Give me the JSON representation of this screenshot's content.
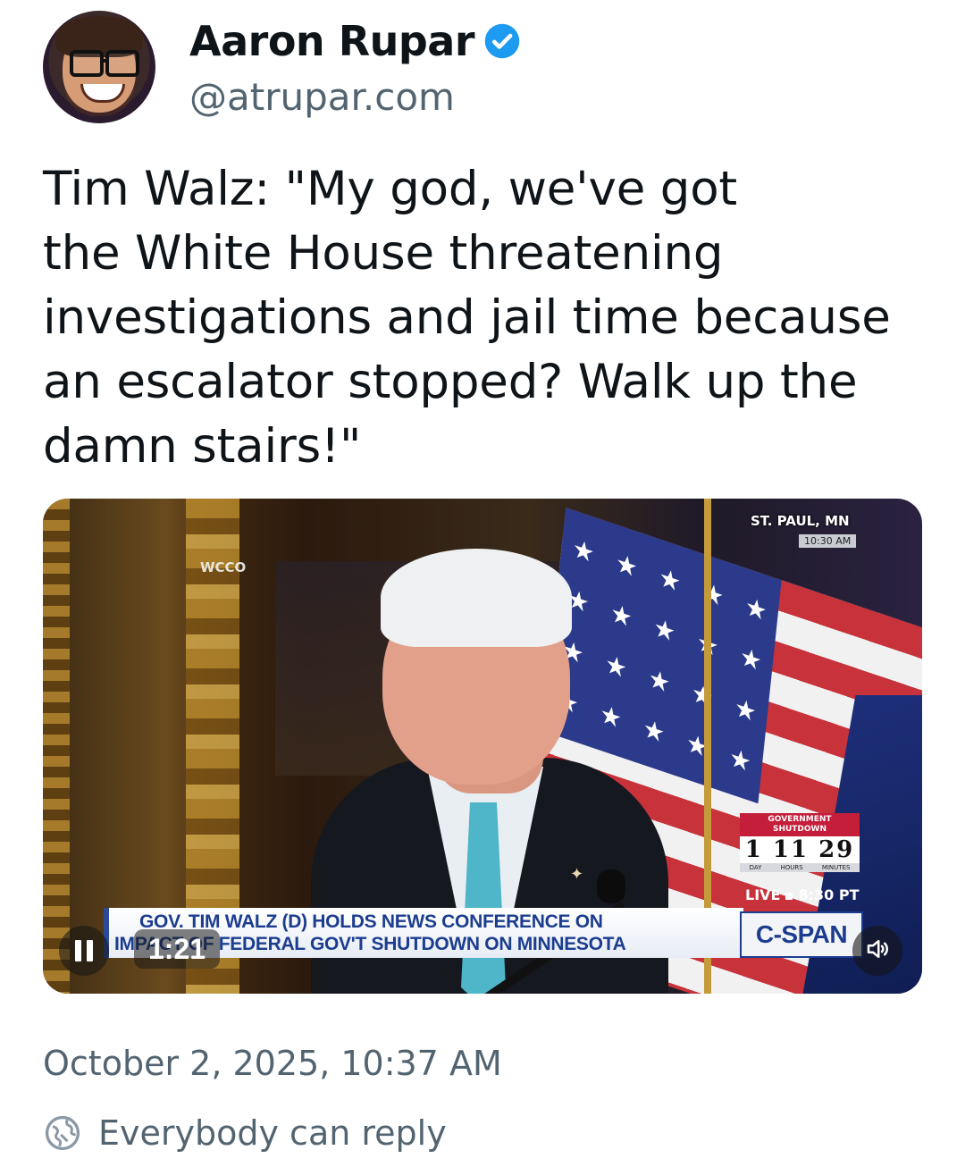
{
  "author": {
    "display_name": "Aaron Rupar",
    "handle": "@atrupar.com",
    "verified": true,
    "verified_color": "#1d9bf0"
  },
  "post": {
    "text": "Tim Walz: \"My god, we've got\nthe White House threatening\ninvestigations and jail time because\nan escalator stopped? Walk up the\ndamn stairs!\""
  },
  "video": {
    "elapsed_time": "1:21",
    "state": "playing",
    "overlays": {
      "station": "WCCO",
      "location": "ST. PAUL, MN",
      "location_time": "10:30 AM",
      "shutdown_label_1": "GOVERNMENT",
      "shutdown_label_2": "SHUTDOWN",
      "shutdown_digits": "1 11 29",
      "shutdown_unit_day": "DAY",
      "shutdown_unit_hours": "HOURS",
      "shutdown_unit_minutes": "MINUTES",
      "live_label": "LIVE",
      "live_time": "8:30 PT",
      "chyron_line1": "GOV. TIM WALZ (D) HOLDS NEWS CONFERENCE ON",
      "chyron_line2": "IMPACT OF FEDERAL GOV'T SHUTDOWN ON MINNESOTA",
      "network": "C-SPAN"
    },
    "icons": {
      "pause": "pause-icon",
      "mute": "speaker-icon"
    }
  },
  "footer": {
    "timestamp": "October 2, 2025, 10:37 AM",
    "reply_setting": "Everybody can reply",
    "reply_icon": "globe-icon"
  },
  "colors": {
    "text_primary": "#0f1419",
    "text_secondary": "#536471",
    "verified_blue": "#1d9bf0"
  }
}
